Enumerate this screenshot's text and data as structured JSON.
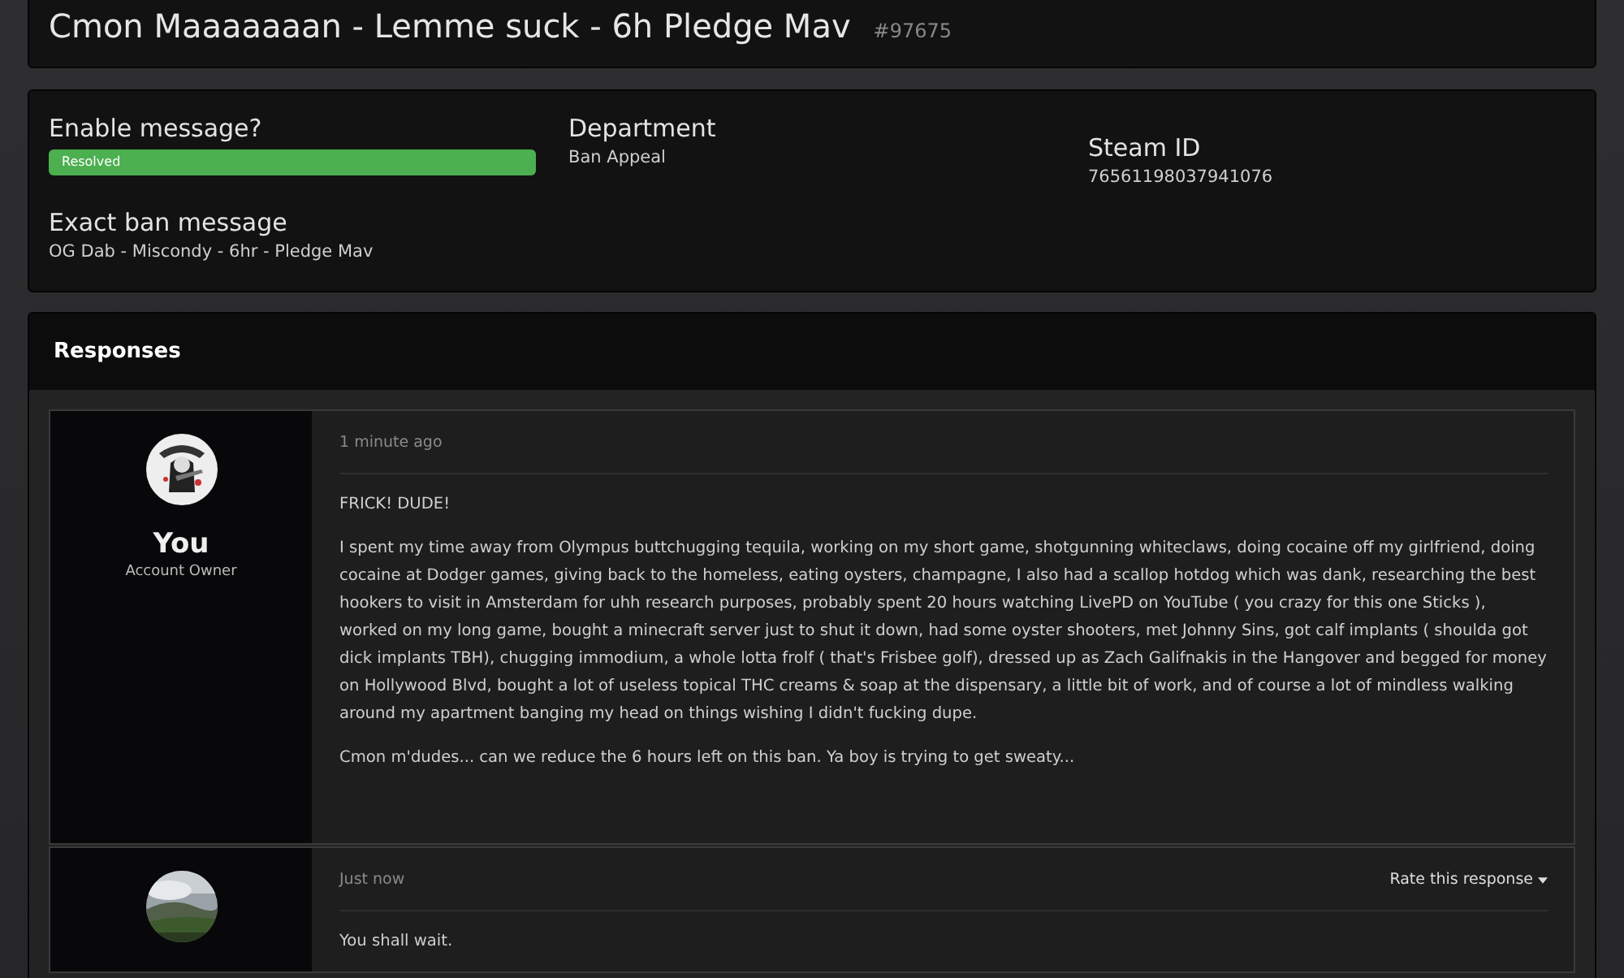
{
  "ticket": {
    "title": "Cmon Maaaaaaan - Lemme suck - 6h Pledge Mav",
    "number": "#97675"
  },
  "details": [
    {
      "kind": "status",
      "label": "Enable message?",
      "status": {
        "kind": "resolved",
        "text": "Resolved"
      }
    },
    {
      "kind": "text",
      "label": "Department",
      "value": "Ban Appeal"
    },
    {
      "kind": "text",
      "label": "Steam ID",
      "value": "76561198037941076"
    },
    {
      "kind": "text",
      "label": "Exact ban message",
      "value": "OG Dab - Miscondy - 6hr - Pledge Mav"
    }
  ],
  "responses": {
    "title": "Responses",
    "posts": [
      {
        "author": "You",
        "role": "Account Owner",
        "time": "1 minute ago",
        "paragraphs": [
          "FRICK! DUDE!",
          "I spent my time away from Olympus buttchugging tequila, working on my short game, shotgunning whiteclaws, doing cocaine off my girlfriend, doing cocaine at Dodger games, giving back to the homeless, eating oysters, champagne, I also had a scallop hotdog which was dank, researching the best hookers to visit in Amsterdam for uhh research purposes, probably spent 20 hours watching LivePD on YouTube ( you crazy for this one Sticks ), worked on my long game, bought a minecraft server just to shut it down, had some oyster shooters, met Johnny Sins, got calf implants ( shoulda got dick implants TBH), chugging immodium, a whole lotta frolf ( that's Frisbee golf), dressed up as Zach Galifnakis in the Hangover and begged for money on Hollywood Blvd, bought a lot of useless topical THC creams & soap at the dispensary, a little bit of work, and of course a lot of mindless walking around my apartment banging my head on things wishing I didn't fucking dupe.",
          "Cmon m'dudes... can we reduce the 6 hours left on this ban. Ya boy is trying to get sweaty..."
        ]
      },
      {
        "time": "Just now",
        "rate": "Rate this response",
        "paragraphs": [
          "You shall wait."
        ]
      }
    ]
  }
}
